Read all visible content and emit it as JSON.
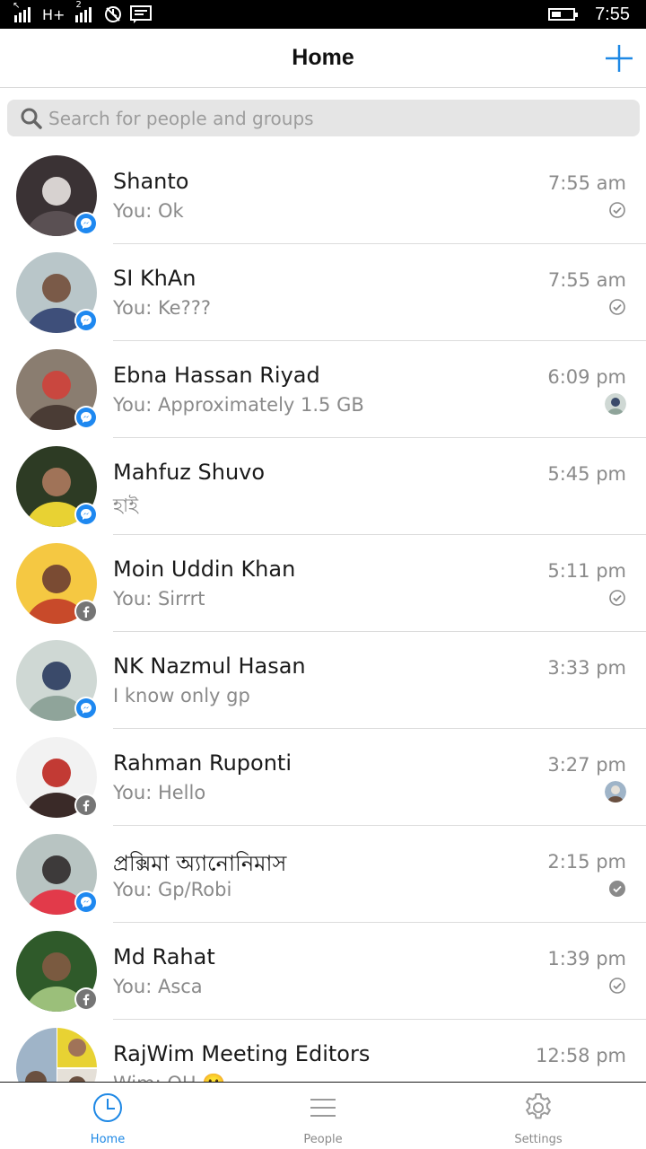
{
  "status_bar": {
    "network": "H+",
    "sim2": "2",
    "time": "7:55",
    "battery_level": 0.4
  },
  "header": {
    "title": "Home",
    "add_icon": "plus-icon"
  },
  "search": {
    "placeholder": "Search for people and groups",
    "icon": "search-icon"
  },
  "conversations": [
    {
      "name": "Shanto",
      "preview": "You: Ok",
      "time": "7:55 am",
      "source": "messenger",
      "status": "sent-check"
    },
    {
      "name": "SI KhAn",
      "preview": "You: Ke???",
      "time": "7:55 am",
      "source": "messenger",
      "status": "sent-check"
    },
    {
      "name": "Ebna Hassan Riyad",
      "preview": "You: Approximately 1.5 GB",
      "time": "6:09 pm",
      "source": "messenger",
      "status": "seen-avatar"
    },
    {
      "name": "Mahfuz Shuvo",
      "preview": "হাই",
      "time": "5:45 pm",
      "source": "messenger",
      "status": "none"
    },
    {
      "name": "Moin Uddin Khan",
      "preview": "You: Sirrrt",
      "time": "5:11 pm",
      "source": "facebook",
      "status": "sent-check"
    },
    {
      "name": "NK Nazmul Hasan",
      "preview": "I know only gp",
      "time": "3:33 pm",
      "source": "messenger",
      "status": "none"
    },
    {
      "name": "Rahman Ruponti",
      "preview": "You: Hello",
      "time": "3:27 pm",
      "source": "facebook",
      "status": "seen-avatar"
    },
    {
      "name": "প্রক্সিমা অ্যানোনিমাস",
      "preview": "You: Gp/Robi",
      "time": "2:15 pm",
      "source": "messenger",
      "status": "delivered-check"
    },
    {
      "name": "Md Rahat",
      "preview": "You: Asca",
      "time": "1:39 pm",
      "source": "facebook",
      "status": "sent-check"
    },
    {
      "name": "RajWim Meeting Editors",
      "preview": "Wim: OH 🙂",
      "time": "12:58 pm",
      "source": "group",
      "status": "none"
    }
  ],
  "tabs": [
    {
      "label": "Home",
      "icon": "clock-icon",
      "active": true
    },
    {
      "label": "People",
      "icon": "list-icon",
      "active": false
    },
    {
      "label": "Settings",
      "icon": "gear-icon",
      "active": false
    }
  ],
  "colors": {
    "accent": "#1e88e5",
    "messenger_badge": "#1e88f0",
    "facebook_badge": "#757575"
  }
}
